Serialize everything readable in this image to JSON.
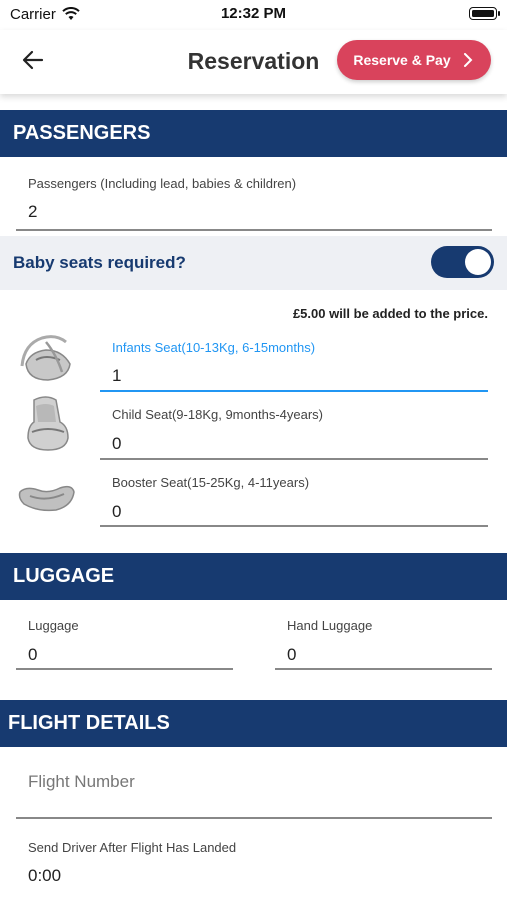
{
  "status_bar": {
    "carrier": "Carrier",
    "time": "12:32 PM"
  },
  "nav": {
    "title": "Reservation",
    "reserve_label": "Reserve & Pay"
  },
  "passengers": {
    "header": "PASSENGERS",
    "label": "Passengers (Including lead, babies & children)",
    "value": "2",
    "baby_seats_label": "Baby seats required?",
    "baby_seats_on": true,
    "price_note": "£5.00 will be added to the price.",
    "seats": [
      {
        "label": "Infants Seat(10-13Kg, 6-15months)",
        "value": "1",
        "icon": "infant-seat-icon"
      },
      {
        "label": "Child Seat(9-18Kg, 9months-4years)",
        "value": "0",
        "icon": "child-seat-icon"
      },
      {
        "label": "Booster Seat(15-25Kg, 4-11years)",
        "value": "0",
        "icon": "booster-seat-icon"
      }
    ]
  },
  "luggage": {
    "header": "LUGGAGE",
    "luggage_label": "Luggage",
    "luggage_value": "0",
    "hand_label": "Hand Luggage",
    "hand_value": "0"
  },
  "flight": {
    "header": "FLIGHT DETAILS",
    "number_placeholder": "Flight Number",
    "send_label": "Send Driver After Flight Has Landed",
    "send_value": "0:00"
  },
  "colors": {
    "brand": "#173a70",
    "accent": "#d9435c",
    "focus": "#2196f3"
  }
}
